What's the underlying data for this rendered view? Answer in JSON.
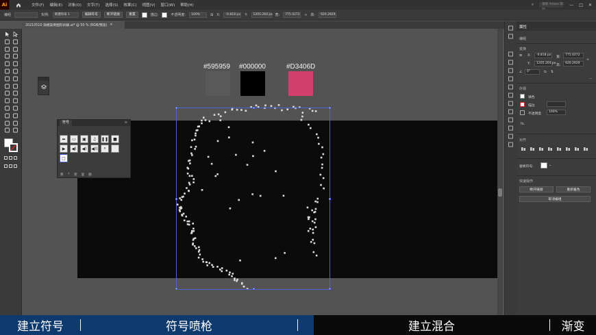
{
  "app": {
    "logo": "Ai"
  },
  "menubar": {
    "items": [
      "文件(F)",
      "编辑(E)",
      "对象(O)",
      "文字(T)",
      "选择(S)",
      "效果(C)",
      "视图(V)",
      "窗口(W)",
      "帮助(H)"
    ],
    "search_placeholder": "搜索 Adobe 帮助"
  },
  "controlbar": {
    "object_label": "编组",
    "symbol_field": "",
    "instance_label": "实例:",
    "instance_value": "新建符号 1",
    "edit_symbol": "编辑符号",
    "break_link": "断开链接",
    "reset": "重置",
    "fill_label": "",
    "stroke_label": "描边:",
    "opacity_label": "不透明度:",
    "opacity_value": "100%",
    "x_label": "X:",
    "x_value": "-0.818 px",
    "y_label": "Y:",
    "y_value": "1205.264 px",
    "w_label": "宽:",
    "w_value": "775.0272",
    "h_label": "高:",
    "h_value": "920.2929"
  },
  "document": {
    "tab_title": "20210510 渐模案例图形拆解.ai* @ 50 % (RGB/预览)",
    "close": "×"
  },
  "swatches": [
    {
      "label": "#595959",
      "color": "#595959"
    },
    {
      "label": "#000000",
      "color": "#000000"
    },
    {
      "label": "#D3406D",
      "color": "#D3406D"
    }
  ],
  "symbols_panel": {
    "title": "符号",
    "footer_items": [
      "库",
      "↑",
      "新",
      "复",
      "删"
    ]
  },
  "properties": {
    "tab": "属性",
    "object_type": "编组",
    "transform_title": "变换",
    "x_label": "X:",
    "x_value": "-0.818 px",
    "y_label": "Y:",
    "y_value": "1205.264 px",
    "w_label": "宽:",
    "w_value": "775.0272",
    "h_label": "高:",
    "h_value": "920.2929",
    "angle_value": "0°",
    "appearance_title": "外观",
    "fill_label": "填色",
    "stroke_label": "描边",
    "opacity_label": "不透明度",
    "opacity_value": "100%",
    "fx_label": "fx.",
    "align_title": "对齐",
    "symbol_label": "替换符号:",
    "quick_actions_title": "快速操作",
    "btn_break_link": "断开链接",
    "btn_recolor": "重新着色",
    "btn_ungroup": "取消编组"
  },
  "captions": [
    "建立符号",
    "符号喷枪",
    "建立混合",
    "渐变"
  ],
  "colors": {
    "caption_blue": "#0f3a6e",
    "caption_dark": "#0a0a0a",
    "artboard": "#0b0b0c",
    "selection": "#4a63d9"
  }
}
